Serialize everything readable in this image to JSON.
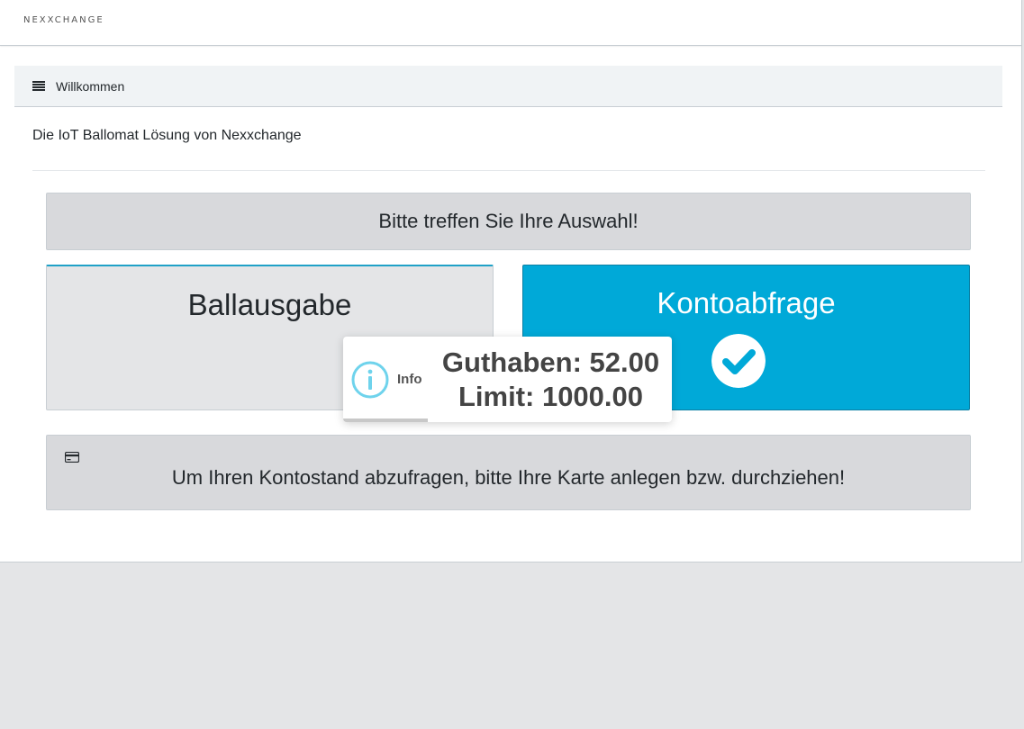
{
  "header": {
    "logo_text": "NEXXCHANGE"
  },
  "card": {
    "title": "Willkommen",
    "icon": "menu-icon",
    "subtitle": "Die IoT Ballomat Lösung von Nexxchange"
  },
  "prompt": {
    "text": "Bitte treffen Sie Ihre Auswahl!"
  },
  "tiles": [
    {
      "label": "Ballausgabe",
      "selected": false
    },
    {
      "label": "Kontoabfrage",
      "selected": true,
      "icon": "check-circle-icon"
    }
  ],
  "toast": {
    "icon": "info-icon",
    "title": "Info",
    "balance_line": "Guthaben: 52.00",
    "limit_line": "Limit: 1000.00"
  },
  "info_box": {
    "icon": "credit-card-icon",
    "text": "Um Ihren Kontostand abzufragen, bitte Ihre Karte anlegen bzw. durchziehen!"
  },
  "colors": {
    "accent": "#00a9d8",
    "panel": "#d8d9dc",
    "header_bg": "#f0f3f5"
  }
}
